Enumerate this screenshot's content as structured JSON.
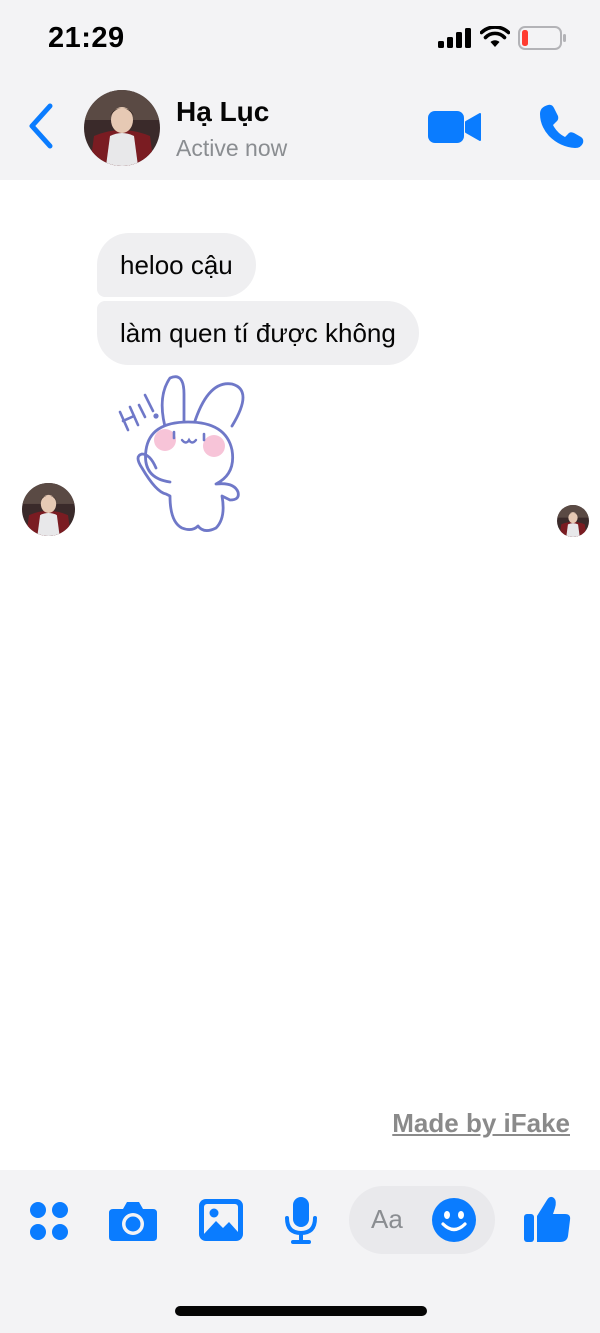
{
  "status_bar": {
    "time": "21:29"
  },
  "header": {
    "contact_name": "Hạ Lục",
    "contact_status": "Active now"
  },
  "messages": [
    {
      "sender": "contact",
      "text": "heloo cậu"
    },
    {
      "sender": "contact",
      "text": "làm quen tí được không"
    }
  ],
  "sticker": {
    "text": "Hi!"
  },
  "watermark": "Made by iFake",
  "composer": {
    "placeholder": "Aa"
  },
  "icons": {
    "back": "chevron-left-icon",
    "video": "video-camera-icon",
    "phone": "phone-icon",
    "more": "four-dots-icon",
    "camera": "camera-icon",
    "gallery": "image-icon",
    "mic": "microphone-icon",
    "emoji": "smiley-icon",
    "like": "thumbs-up-icon"
  },
  "colors": {
    "accent": "#0a7cff",
    "bubble": "#efeff1",
    "bar_bg": "#f3f3f5",
    "battery_low": "#ff3b30"
  }
}
